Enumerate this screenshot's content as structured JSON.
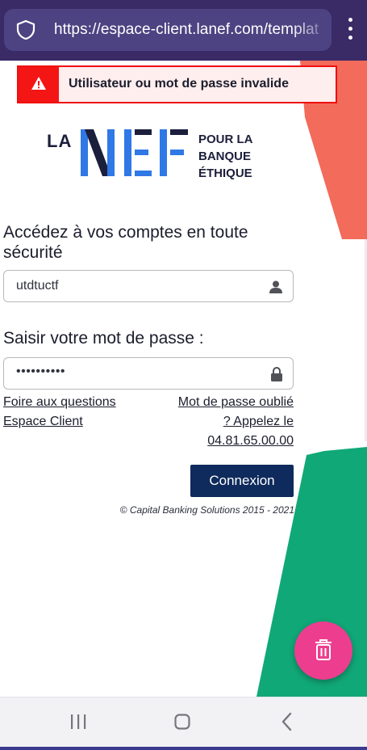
{
  "browser": {
    "url": "https://espace-client.lanef.com/templat"
  },
  "alert": {
    "message": "Utilisateur ou mot de passe invalide"
  },
  "logo": {
    "la": "LA",
    "tagline_line1": "POUR LA",
    "tagline_line2": "BANQUE",
    "tagline_line3": "ÉTHIQUE"
  },
  "login": {
    "heading": "Accédez à vos comptes en toute sécurité",
    "username_value": "utdtuctf",
    "password_heading": "Saisir votre mot de passe :",
    "password_masked": "••••••••••",
    "faq_line1": "Foire aux questions",
    "faq_line2": "Espace Client",
    "forgot_line1": "Mot de passe oublié",
    "forgot_line2": "? Appelez le",
    "forgot_line3": "04.81.65.00.00",
    "submit_label": "Connexion",
    "copyright": "© Capital Banking Solutions 2015 - 2021"
  },
  "colors": {
    "browser_bar": "#3a2a66",
    "alert_red": "#f41515",
    "button_navy": "#0f2a5c",
    "deco_coral": "#f26b5b",
    "deco_green": "#11a877",
    "fab_pink": "#ed3d8f"
  },
  "icons": {
    "browser": [
      "shield-icon",
      "more-vert-icon"
    ],
    "alert": "warning-icon",
    "username": "user-icon",
    "password": "lock-icon",
    "fab": "trash-icon",
    "navigation": [
      "recents-icon",
      "home-icon",
      "back-icon"
    ]
  }
}
